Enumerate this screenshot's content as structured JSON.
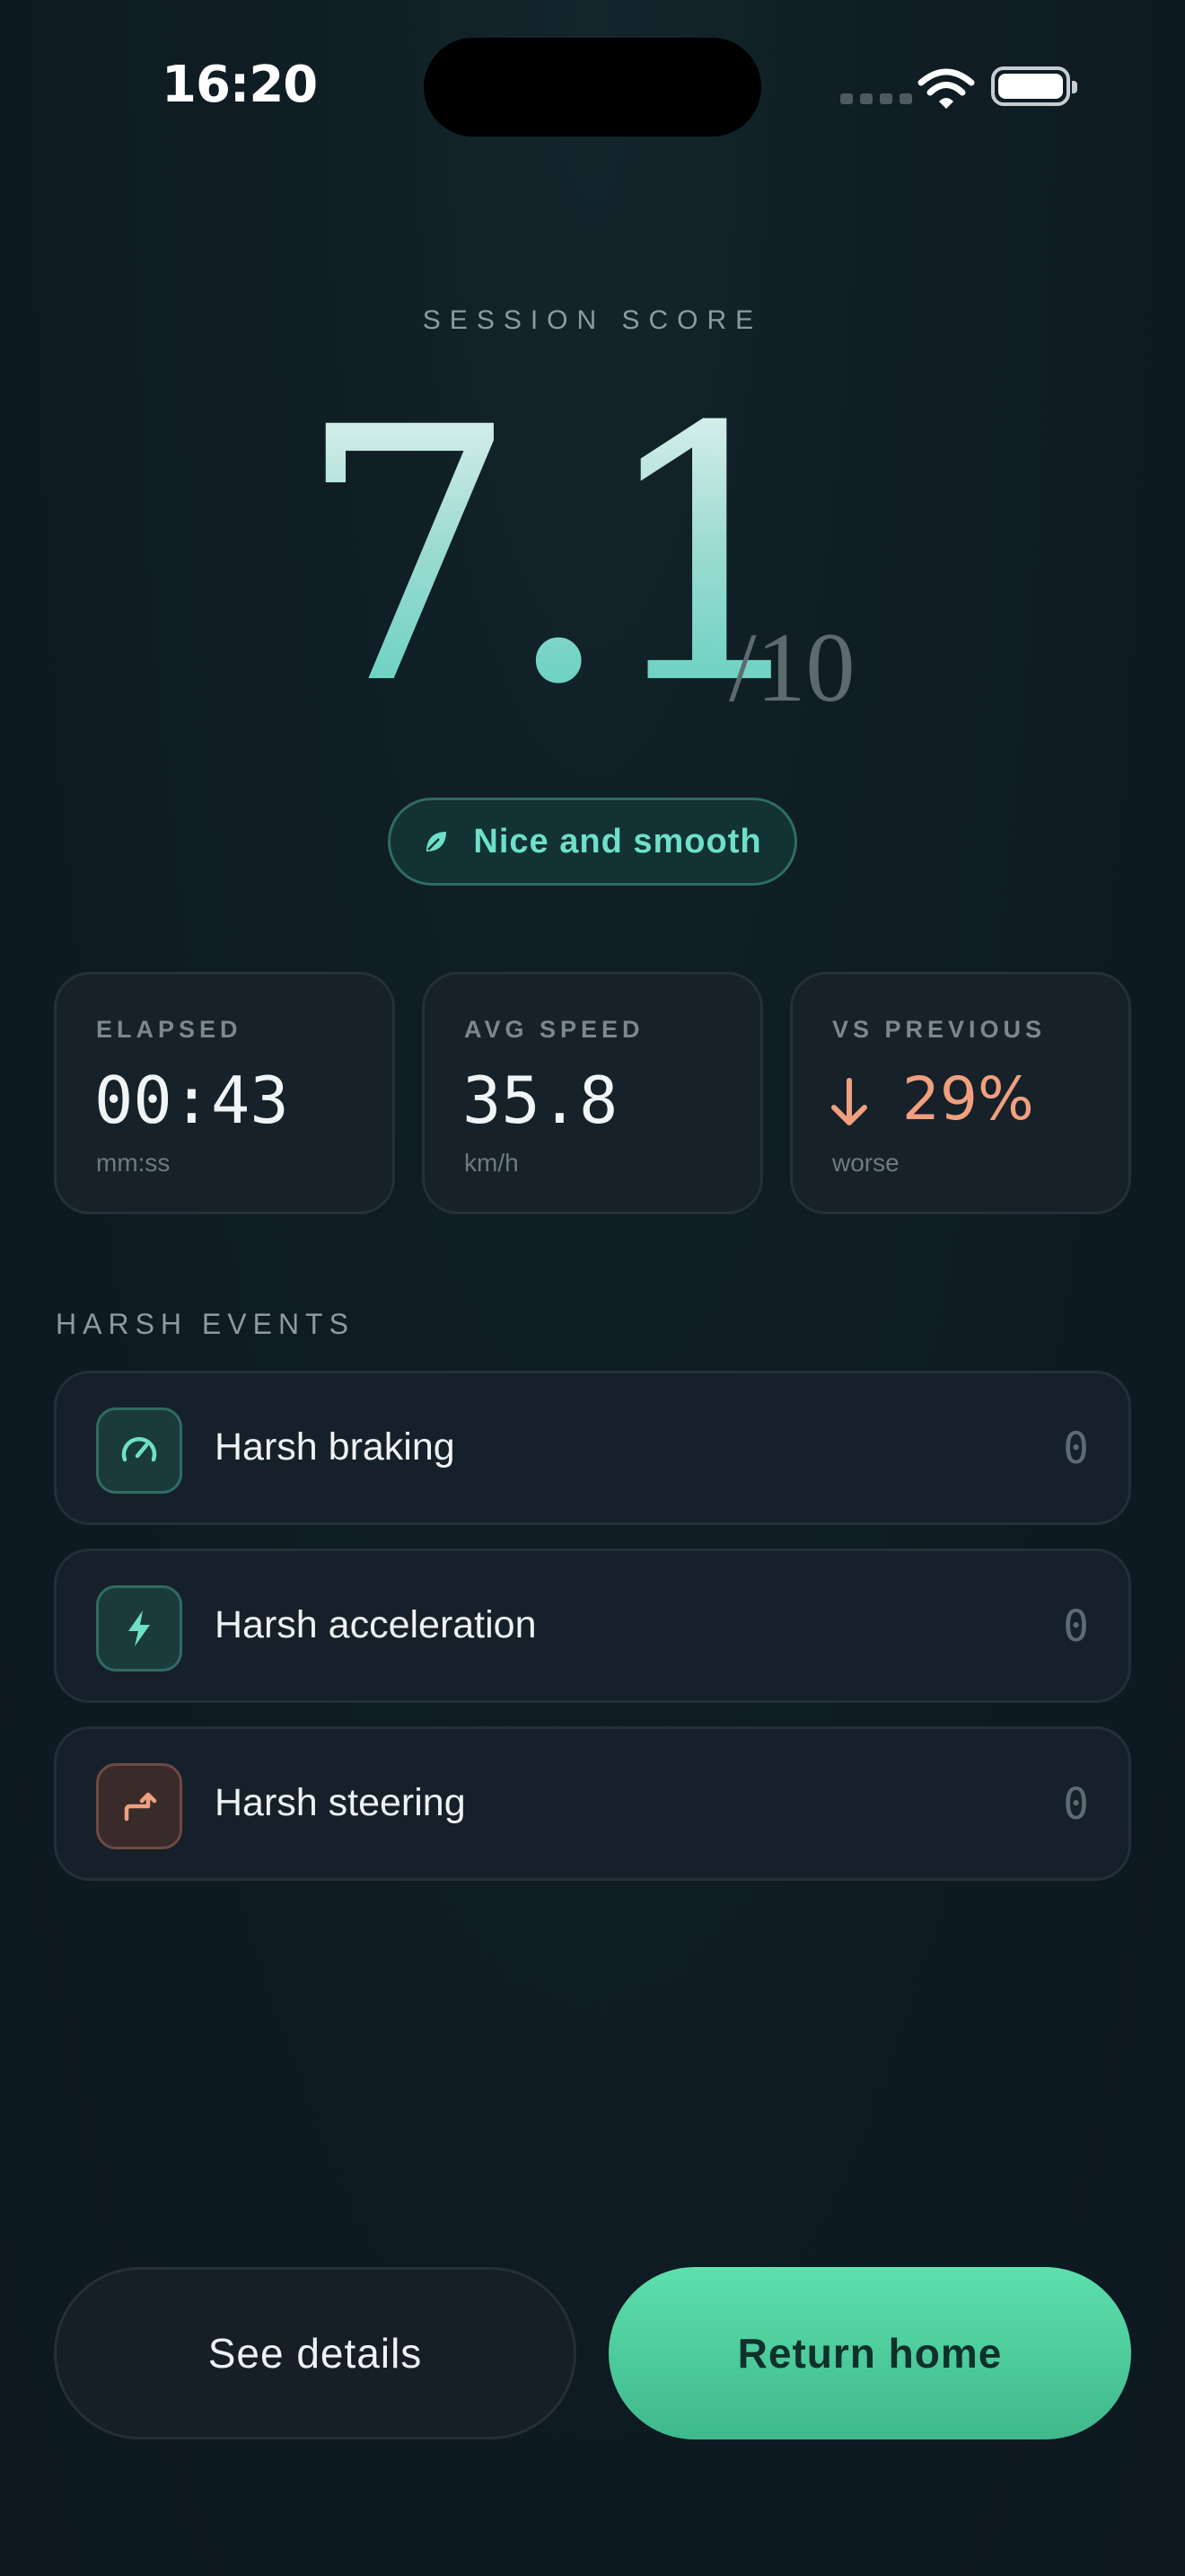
{
  "status_bar": {
    "time": "16:20"
  },
  "score": {
    "label": "SESSION SCORE",
    "value": "7.1",
    "max": "/10"
  },
  "badge": {
    "icon": "leaf-icon",
    "text": "Nice and smooth"
  },
  "stats": [
    {
      "label": "ELAPSED",
      "value": "00:43",
      "unit": "mm:ss"
    },
    {
      "label": "AVG SPEED",
      "value": "35.8",
      "unit": "km/h"
    },
    {
      "label": "VS PREVIOUS",
      "value": "29%",
      "unit": "worse",
      "trend_icon": "arrow-down-icon"
    }
  ],
  "events": {
    "label": "HARSH EVENTS",
    "items": [
      {
        "name": "Harsh braking",
        "count": "0",
        "icon": "speedometer-icon"
      },
      {
        "name": "Harsh acceleration",
        "count": "0",
        "icon": "lightning-icon"
      },
      {
        "name": "Harsh steering",
        "count": "0",
        "icon": "turn-arrow-icon"
      }
    ]
  },
  "actions": {
    "secondary": "See details",
    "primary": "Return home"
  },
  "colors": {
    "accent": "#5ecfbd",
    "primary_button": "#4fcf9e",
    "worse": "#f0a07f"
  }
}
